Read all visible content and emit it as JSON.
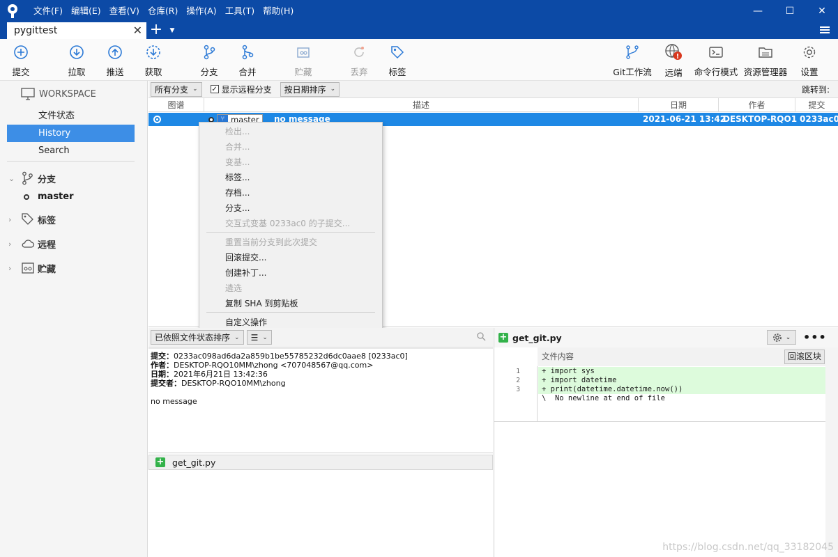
{
  "menu": [
    "文件(F)",
    "编辑(E)",
    "查看(V)",
    "仓库(R)",
    "操作(A)",
    "工具(T)",
    "帮助(H)"
  ],
  "window_controls": {
    "minimize": "—",
    "maximize": "☐",
    "close": "✕"
  },
  "tab": {
    "title": "pygittest",
    "close": "✕",
    "add": "+",
    "dropdown": "▼"
  },
  "toolbar": {
    "commit": "提交",
    "pull": "拉取",
    "push": "推送",
    "fetch": "获取",
    "branch": "分支",
    "merge": "合并",
    "stash": "贮藏",
    "discard": "丢弃",
    "tag": "标签",
    "gitflow": "Git工作流",
    "remote": "远端",
    "terminal": "命令行模式",
    "explorer": "资源管理器",
    "settings": "设置"
  },
  "sidebar": {
    "workspace": "WORKSPACE",
    "nav": [
      "文件状态",
      "History",
      "Search"
    ],
    "branches_label": "分支",
    "branch": "master",
    "tags_label": "标签",
    "remotes_label": "远程",
    "stashes_label": "贮藏"
  },
  "filter": {
    "branches": "所有分支",
    "show_remote": "显示远程分支",
    "sort": "按日期排序",
    "jump_to": "跳转到:"
  },
  "history": {
    "columns": {
      "graph": "图谱",
      "description": "描述",
      "date": "日期",
      "author": "作者",
      "commit": "提交"
    },
    "rows": [
      {
        "branch": "master",
        "message": "no message",
        "date": "2021-06-21 13:42",
        "author": "DESKTOP-RQO1",
        "commit": "0233ac0"
      }
    ]
  },
  "context_menu": {
    "items": [
      {
        "label": "检出...",
        "enabled": false
      },
      {
        "label": "合并...",
        "enabled": false
      },
      {
        "label": "变基...",
        "enabled": false
      },
      {
        "label": "标签...",
        "enabled": true
      },
      {
        "label": "存档...",
        "enabled": true
      },
      {
        "label": "分支...",
        "enabled": true
      },
      {
        "label": "交互式变基 0233ac0 的子提交...",
        "enabled": false
      },
      {
        "label": "重置当前分支到此次提交",
        "enabled": false
      },
      {
        "label": "回滚提交...",
        "enabled": true
      },
      {
        "label": "创建补丁...",
        "enabled": true
      },
      {
        "label": "遴选",
        "enabled": false
      },
      {
        "label": "复制 SHA 到剪贴板",
        "enabled": true
      },
      {
        "label": "自定义操作",
        "enabled": true
      }
    ]
  },
  "details": {
    "sort_by_status": "已依照文件状态排序",
    "view_mode": "☰",
    "commit_label": "提交：",
    "commit_value": "0233ac098ad6da2a859b1be55785232d6dc0aae8 [0233ac0]",
    "author_label": "作者：",
    "author_value": "DESKTOP-RQO10MM\\zhong <707048567@qq.com>",
    "date_label": "日期：",
    "date_value": "2021年6月21日 13:42:36",
    "committer_label": "提交者：",
    "committer_value": "DESKTOP-RQO10MM\\zhong",
    "message": "no message",
    "files": [
      "get_git.py"
    ]
  },
  "diff": {
    "file": "get_git.py",
    "more": "•••",
    "hunk_header": "文件内容",
    "revert_hunk": "回滚区块",
    "line_numbers": [
      "1",
      "2",
      "3"
    ],
    "lines": [
      {
        "text": "+ import sys",
        "type": "added"
      },
      {
        "text": "+ import datetime",
        "type": "added"
      },
      {
        "text": "+ print(datetime.datetime.now())",
        "type": "added"
      },
      {
        "text": "\\  No newline at end of file",
        "type": "meta"
      }
    ]
  },
  "watermark": "https://blog.csdn.net/qq_33182045",
  "colors": {
    "titlebar": "#0c4aa6",
    "selection": "#1e88e5",
    "sidebar_active": "#3d8ee6",
    "added_line": "#ddfbdc"
  }
}
